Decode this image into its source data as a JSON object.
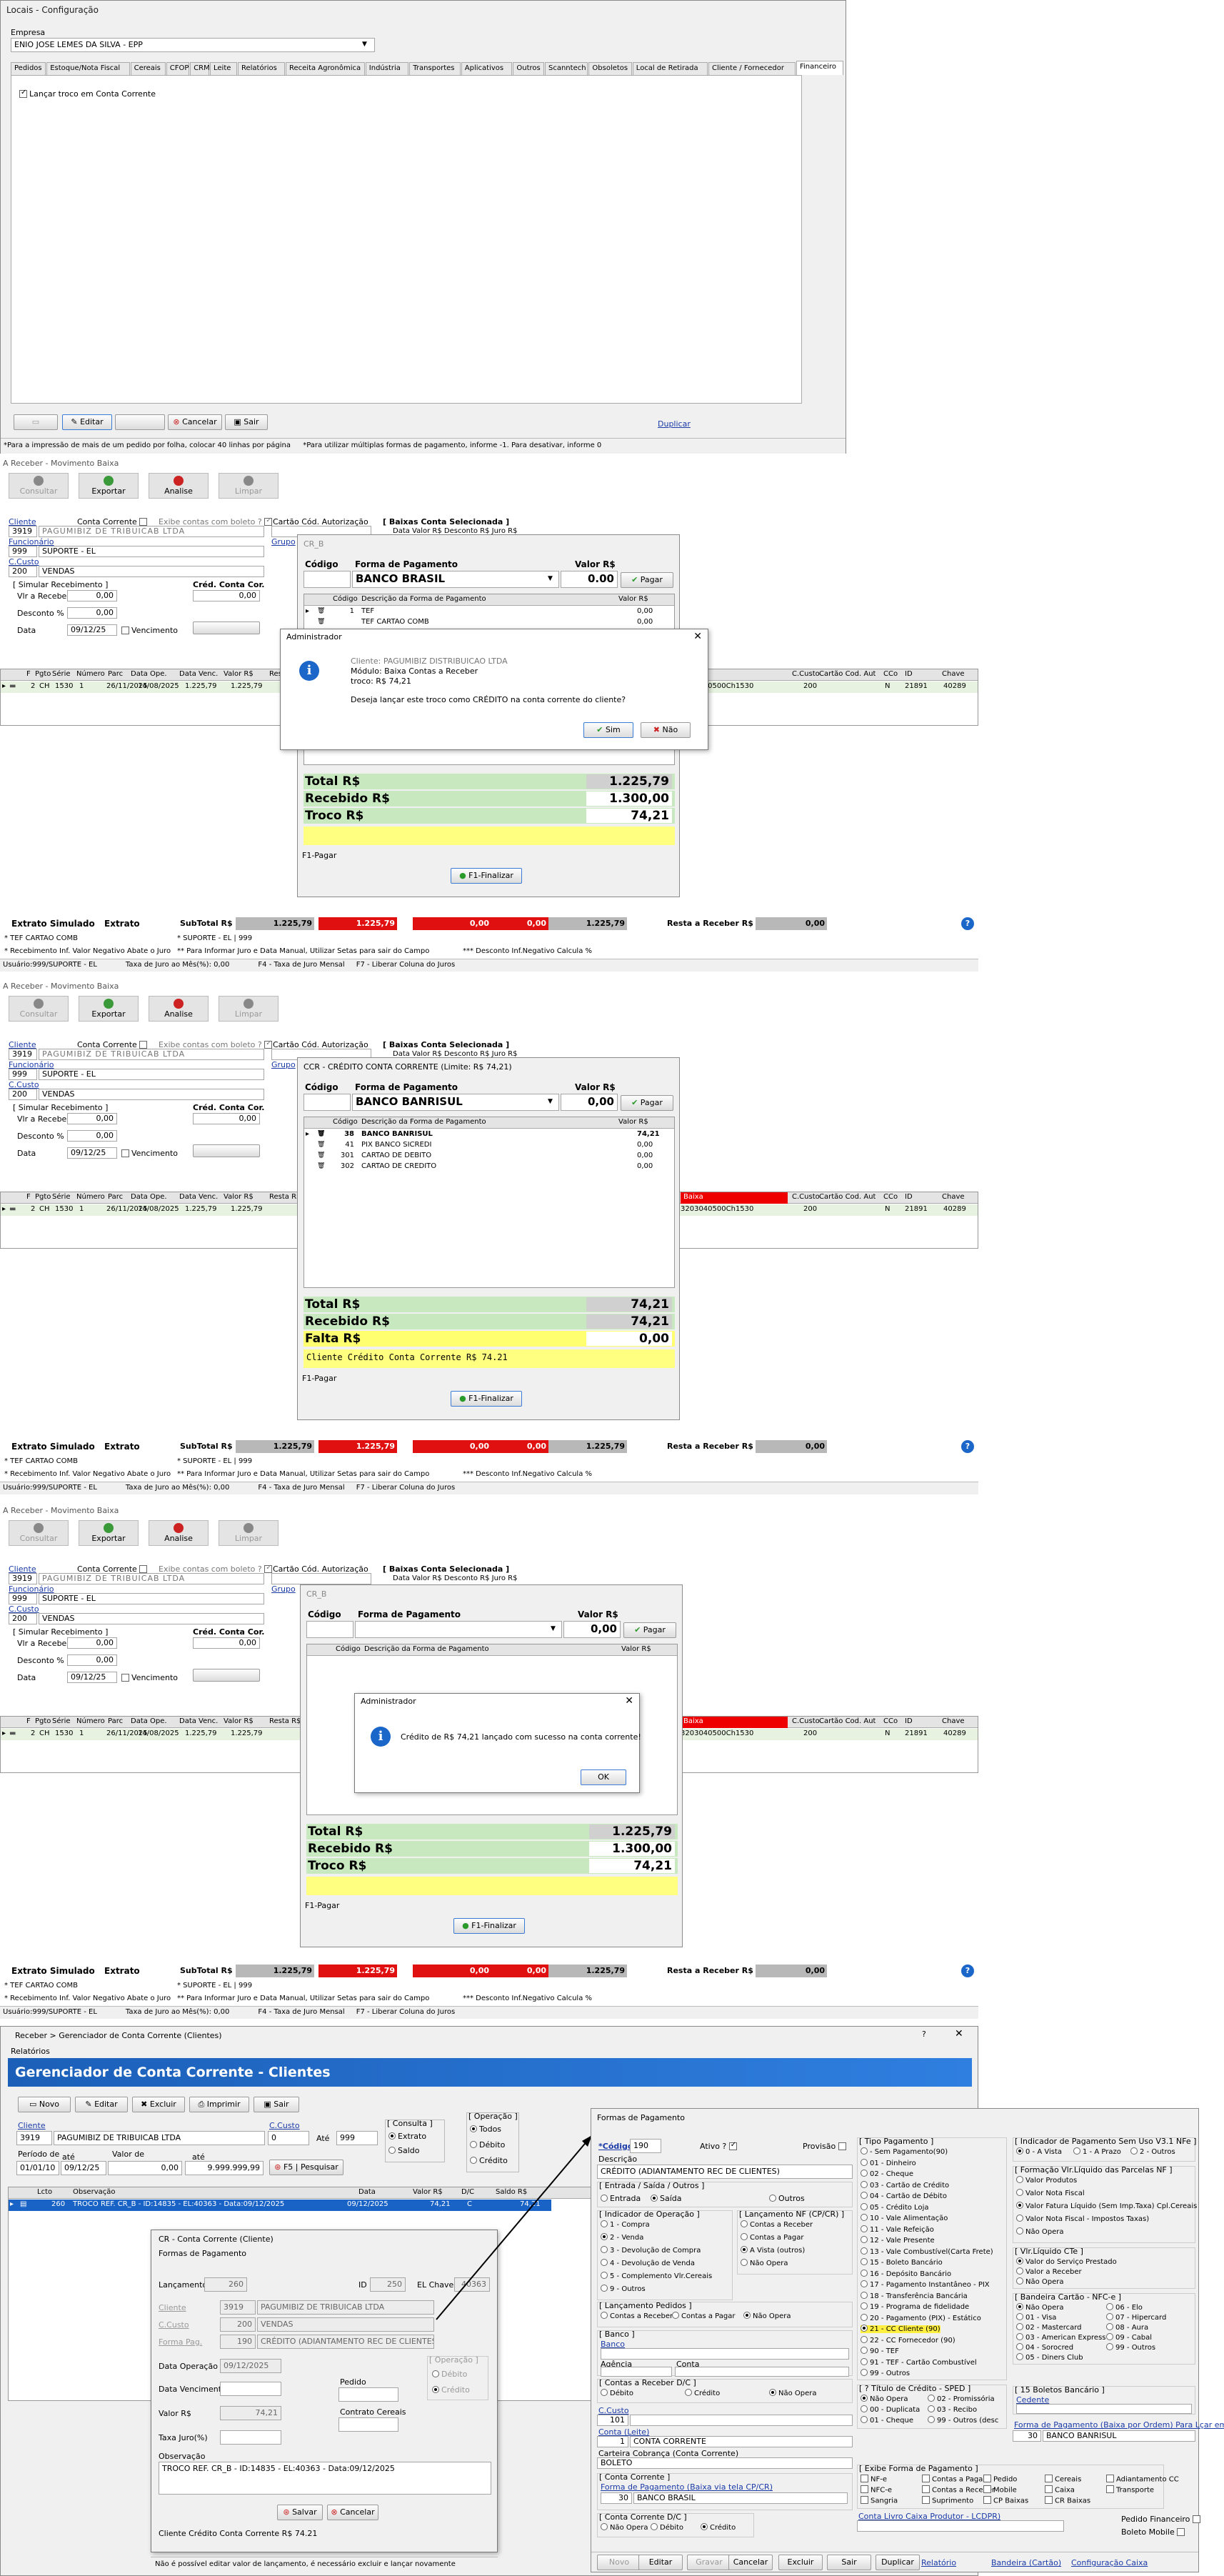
{
  "cfg": {
    "title": "Locais - Configuração",
    "empresa_label": "Empresa",
    "empresa_value": "ENIO JOSE LEMES DA SILVA - EPP",
    "tabs": [
      "Pedidos",
      "Estoque/Nota Fiscal",
      "Cereais",
      "CFOP",
      "CRM",
      "Leite",
      "Relatórios",
      "Receita Agronômica",
      "Indústria",
      "Transportes",
      "Aplicativos",
      "Outros",
      "Scanntech",
      "Obsoletos",
      "Local de Retirada",
      "Cliente / Fornecedor",
      "Financeiro"
    ],
    "check_label": "Lançar troco em Conta Corrente",
    "btn_editar": "Editar",
    "btn_cancelar": "Cancelar",
    "btn_sair": "Sair",
    "btn_duplicar": "Duplicar",
    "status1": "*Para a impressão de mais de um pedido por folha, colocar 40 linhas por página",
    "status2": "*Para utilizar múltiplas formas de pagamento, informe -1. Para desativar, informe 0"
  },
  "rec": {
    "title": "A Receber - Movimento Baixa",
    "tb": [
      "Consultar",
      "Exportar",
      "Analise",
      "Limpar"
    ],
    "cliente_label": "Cliente",
    "cliente_code": "3919",
    "cliente_name": "PAGUMIBIZ DE TRIBUICAB LTDA",
    "conta_corrente": "Conta Corrente",
    "exibe_boleto": "Exibe contas com boleto ?",
    "cartao_cod": "Cartão Cód. Autorização",
    "grupo": "Grupo",
    "funcionario_label": "Funcionário",
    "func_code": "999",
    "func_name": "SUPORTE - EL",
    "ccusto_label": "C.Custo",
    "ccusto_code": "200",
    "ccusto_name": "VENDAS",
    "simular": "[ Simular Recebimento ]",
    "vlr_receber": "Vlr a Receber",
    "desconto": "Desconto %",
    "data": "Data",
    "data_val": "09/12/25",
    "zero": "0,00",
    "vencimento": "Vencimento",
    "cred_cc": "Créd. Conta Cor.",
    "baixas": "[ Baixas Conta Selecionada ]",
    "baixas_cols": "Data      Valor R$   Desconto R$   Juro R$",
    "grid_cols": [
      "F",
      "Pgto",
      "Série",
      "Número",
      "Parc",
      "Data Ope.",
      "Data Venc.",
      "Valor R$",
      "Resta R$"
    ],
    "grid_row": [
      "2",
      "CH",
      "1530",
      "1",
      "26/11/2025",
      "14/08/2025",
      "1.225,79",
      "1.225,79"
    ],
    "grid_right": [
      "C.Custo",
      "Cartão Cod. Aut",
      "CCo",
      "ID",
      "Chave"
    ],
    "grid_right_row": [
      "200",
      "",
      "N",
      "21891",
      "40289"
    ],
    "baixa": "Baixa",
    "chave_long": "3203040500Ch1530",
    "extrato_simulado": "Extrato Simulado",
    "extrato": "Extrato",
    "subtotal": "SubTotal R$",
    "v1": "1.225,79",
    "v2": "1.225,79",
    "v3": "0,00",
    "v4": "0,00",
    "v5": "1.225,79",
    "resta_receber": "Resta a Receber R$",
    "resta_val": "0,00",
    "l1a": "* TEF CARTAO COMB",
    "l1b": "* SUPORTE - EL | 999",
    "l2a": "* Recebimento Inf. Valor Negativo Abate o Juro",
    "l2b": "** Para Informar Juro e Data Manual, Utilizar Setas para sair do Campo",
    "l2c": "*** Desconto Inf.Negativo Calcula %",
    "l3a": "Usuário:999/SUPORTE - EL",
    "l3b": "Taxa de Juro ao Mês(%): 0,00",
    "l3c": "F4 - Taxa de Juro Mensal",
    "l3d": "F7 - Liberar Coluna do Juros"
  },
  "p1": {
    "caption": "CR_B",
    "codigo": "Código",
    "forma": "Forma de Pagamento",
    "valor": "Valor R$",
    "forma_val": "BANCO BRASIL",
    "valor_val": "0.00",
    "pagar": "Pagar",
    "col_code": "Código",
    "col_desc": "Descrição da Forma de Pagamento",
    "col_val": "Valor R$",
    "rows": [
      [
        "1",
        "TEF",
        "0,00"
      ],
      [
        "",
        "TEF CARTAO COMB",
        "0,00"
      ]
    ],
    "total_l": "Total R$",
    "total_v": "1.225,79",
    "receb_l": "Recebido R$",
    "receb_v": "1.300,00",
    "troco_l": "Troco R$",
    "troco_v": "74,21",
    "f1": "F1-Pagar",
    "finalizar": "F1-Finalizar"
  },
  "d1": {
    "title": "Administrador",
    "l1": "Cliente: PAGUMIBIZ DISTRIBUICAO LTDA",
    "l2": "Módulo: Baixa Contas a Receber",
    "l3": "troco: R$ 74,21",
    "q": "Deseja lançar este troco como CRÉDITO na conta corrente do cliente?",
    "sim": "Sim",
    "nao": "Não"
  },
  "p2": {
    "caption": "CCR - CRÉDITO CONTA CORRENTE (Limite: R$ 74,21)",
    "forma_val": "BANCO BANRISUL",
    "valor_val": "0,00",
    "rows": [
      [
        "38",
        "BANCO BANRISUL",
        "74,21"
      ],
      [
        "41",
        "PIX BANCO SICREDI",
        "0,00"
      ],
      [
        "301",
        "CARTAO DE DEBITO",
        "0,00"
      ],
      [
        "302",
        "CARTAO DE CREDITO",
        "0,00"
      ]
    ],
    "total_v": "74,21",
    "receb_v": "74,21",
    "falta_l": "Falta R$",
    "falta_v": "0,00",
    "msg": "Cliente Crédito Conta Corrente R$ 74.21"
  },
  "d2": {
    "title": "Administrador",
    "msg": "Crédito de R$ 74,21 lançado com sucesso na conta corrente!",
    "ok": "OK"
  },
  "gcc": {
    "crumb": "Receber > Gerenciador de Conta Corrente (Clientes)",
    "menu": "Relatórios",
    "header": "Gerenciador de Conta Corrente - Clientes",
    "tb": [
      "Novo",
      "Editar",
      "Excluir",
      "Imprimir",
      "Sair"
    ],
    "cliente": "Cliente",
    "ccusto": "C.Custo",
    "ccusto_val": "0",
    "ate": "Até",
    "ate_val": "999",
    "consulta": "[ Consulta ]",
    "extrato": "Extrato",
    "saldo": "Saldo",
    "operacao": "[ Operação ]",
    "todos": "Todos",
    "debito": "Débito",
    "credito": "Crédito",
    "periodo": "Período de",
    "ate2": "até",
    "valor_de": "Valor de",
    "periodo_de": "01/01/10",
    "periodo_ate": "09/12/25",
    "vd": "0,00",
    "va": "9.999.999,99",
    "pesquisar": "F5 | Pesquisar",
    "cols": [
      "Lcto",
      "Observação",
      "Data",
      "Valor R$",
      "D/C",
      "Saldo R$"
    ],
    "row": [
      "260",
      "TROCO REF. CR_B - ID:14835 - EL:40363 - Data:09/12/2025",
      "09/12/2025",
      "74,21",
      "C",
      "74,21"
    ]
  },
  "crd": {
    "title": "CR - Conta Corrente (Cliente)",
    "sub": "Formas de Pagamento",
    "lanc": "Lançamento",
    "lanc_val": "260",
    "id": "ID",
    "id_val": "250",
    "elchave": "EL Chave",
    "el_val": "40363",
    "cliente": "Cliente",
    "ccusto": "C.Custo",
    "ccusto_val": "200",
    "ccusto_name": "VENDAS",
    "forma": "Forma Pag.",
    "forma_code": "190",
    "forma_name": "CRÉDITO (ADIANTAMENTO REC DE CLIENTES)",
    "operacao": "[ Operação ]",
    "debito": "Débito",
    "credito": "Crédito",
    "data_op": "Data Operação",
    "data_op_val": "09/12/2025",
    "data_venc": "Data Vencimento",
    "pedido": "Pedido",
    "valor": "Valor R$",
    "valor_val": "74,21",
    "contrato": "Contrato Cereais",
    "taxa": "Taxa Juro(%)",
    "obs": "Observação",
    "obs_val": "TROCO REF. CR_B - ID:14835 - EL:40363 - Data:09/12/2025",
    "salvar": "Salvar",
    "cancelar": "Cancelar",
    "foot": "Cliente Crédito Conta Corrente R$ 74.21",
    "status": "Não é possível editar valor de lançamento, é necessário excluir e lançar novamente"
  },
  "fp": {
    "title": "Formas de Pagamento",
    "codigo": "*Código",
    "codigo_val": "190",
    "ativo": "Ativo ?",
    "provisao": "Provisão",
    "descricao": "Descrição",
    "descricao_val": "CRÉDITO (ADIANTAMENTO REC DE CLIENTES)",
    "es": "[ Entrada / Saída / Outros ]",
    "entrada": "Entrada",
    "saida": "Saída",
    "outros": "Outros",
    "ind_op": "[ Indicador de Operação ]",
    "ops": [
      "1 - Compra",
      "2 - Venda",
      "3 - Devolução de Compra",
      "4 - Devolução de Venda",
      "5 - Complemento Vlr.Cereais",
      "9 - Outros"
    ],
    "lnf": "[ Lançamento NF (CP/CR) ]",
    "lnfs": [
      "Contas a Receber",
      "Contas a Pagar",
      "A Vista (outros)",
      "Não Opera"
    ],
    "lped": "[ Lançamento Pedidos ]",
    "lpeds": [
      "Contas a Receber",
      "Contas a Pagar",
      "Não Opera"
    ],
    "banco_box": "[ Banco ]",
    "banco": "Banco",
    "agencia": "Agência",
    "conta": "Conta",
    "cbdc": "[ Contas a Receber D/C ]",
    "cbdcs": [
      "Débito",
      "Crédito",
      "Não Opera"
    ],
    "ccusto": "C.Custo",
    "ccusto_val": "101",
    "contaleite": "Conta (Leite)",
    "contaleite_val": "1",
    "contaleite_name": "CONTA CORRENTE",
    "carteira": "Carteira Cobrança  (Conta Corrente)",
    "carteira_val": "BOLETO",
    "cc_box": "[ Conta Corrente ]",
    "cc_forma": "Forma de Pagamento (Baixa via tela CP/CR)",
    "cc_code": "30",
    "cc_name": "BANCO BRASIL",
    "cc_dc": "[ Conta Corrente D/C ]",
    "cc_dcs": [
      "Não Opera",
      "Débito",
      "Crédito"
    ],
    "tipo": "[ Tipo Pagamento ]",
    "tipos": [
      "- Sem Pagamento(90)",
      "01 - Dinheiro",
      "02 - Cheque",
      "03 - Cartão de Crédito",
      "04 - Cartão de Débito",
      "05 - Crédito Loja",
      "10 - Vale Alimentação",
      "11 - Vale Refeição",
      "12 - Vale Presente",
      "13 - Vale Combustível(Carta Frete)",
      "15 - Boleto Bancário",
      "16 - Depósito Bancário",
      "17 - Pagamento Instantâneo - PIX",
      "18 - Transferência Bancária",
      "19 - Programa de fidelidade",
      "20 - Pagamento (PIX) - Estático",
      "21 - CC Cliente (90)",
      "22 - CC Fornecedor (90)",
      "90 - TEF",
      "91 - TEF - Cartão Combustível",
      "99 - Outros"
    ],
    "ind_pag": "[ Indicador de Pagamento Sem Uso V3.1 NFe ]",
    "ind_pags": [
      "0 - A Vista",
      "1 - A Prazo",
      "2 - Outros"
    ],
    "vliq": "[ Formação Vlr.Líquido das Parcelas NF ]",
    "vliqs": [
      "Valor Produtos",
      "Valor Nota Fiscal",
      "Valor Fatura Líquido (Sem Imp.Taxa) Cpl.Cereais",
      "Valor Nota Fiscal - Impostos Taxas)",
      "Não Opera"
    ],
    "vliqcte": "[ Vlr.Líquido CTe ]",
    "vliqctes": [
      "Valor do Serviço Prestado",
      "Valor a Receber",
      "Não Opera"
    ],
    "bandeira": "[ Bandeira Cartão - NFC-e ]",
    "bands": [
      "Não Opera",
      "01 - Visa",
      "02 - Mastercard",
      "03 - American Express",
      "04 - Sorocred",
      "05 - Diners Club",
      "06 - Elo",
      "07 - Hipercard",
      "08 - Aura",
      "09 - Cabal",
      "99 - Outros"
    ],
    "titulo": "[ ? Título de Crédito - SPED ]",
    "titulos": [
      "Não Opera",
      "00 - Duplicata",
      "01 - Cheque",
      "02 - Promissória",
      "03 - Recibo",
      "99 - Outros (desc"
    ],
    "boletos": "[ 15 Boletos Bancário ]",
    "cedente": "Cedente",
    "fpc": "Forma de Pagamento (Baixa por Ordem) Para Lçar em Carteira",
    "fpc_code": "30",
    "fpc_name": "BANCO BANRISUL",
    "exibe": "[ Exibe Forma de Pagamento ]",
    "exibes": [
      "NF-e",
      "Contas a Pagar",
      "Pedido",
      "Cereais",
      "Adiantamento CC",
      "NFC-e",
      "Contas a Receber",
      "Mobile",
      "Caixa",
      "Transporte",
      "Sangria",
      "Suprimento",
      "CP Baixas",
      "CR Baixas"
    ],
    "cfp": "Conta Livro Caixa Produtor - LCDPR)",
    "pf": "Pedido Financeiro",
    "bm": "Boleto Mobile",
    "foot": [
      "Novo",
      "Editar",
      "Gravar",
      "Cancelar",
      "Excluir",
      "Sair",
      "Duplicar",
      "Relatório",
      "Bandeira (Cartão)",
      "Configuração Caixa"
    ]
  }
}
